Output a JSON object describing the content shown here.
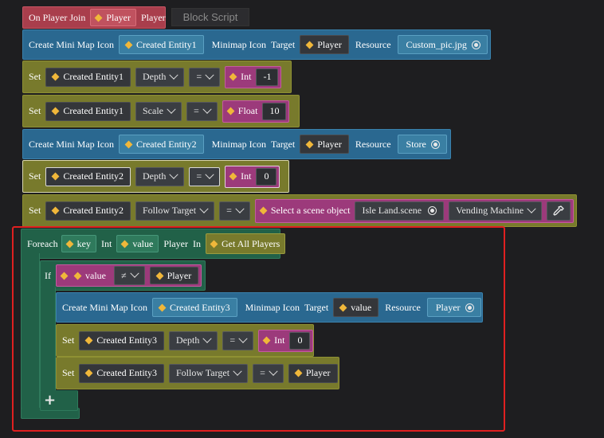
{
  "header": {
    "event_label": "On Player Join",
    "player_chip": "Player",
    "player_text": "Player",
    "block_script_button": "Block Script"
  },
  "rows": {
    "r1": {
      "create": "Create Mini Map Icon",
      "entity": "Created Entity1",
      "minimap": "Minimap Icon",
      "target": "Target",
      "target_val": "Player",
      "resource": "Resource",
      "resource_val": "Custom_pic.jpg"
    },
    "r2": {
      "set": "Set",
      "entity": "Created Entity1",
      "prop": "Depth",
      "op": "=",
      "type": "Int",
      "value": "-1"
    },
    "r3": {
      "set": "Set",
      "entity": "Created Entity1",
      "prop": "Scale",
      "op": "=",
      "type": "Float",
      "value": "10"
    },
    "r4": {
      "create": "Create Mini Map Icon",
      "entity": "Created Entity2",
      "minimap": "Minimap Icon",
      "target": "Target",
      "target_val": "Player",
      "resource": "Resource",
      "resource_val": "Store"
    },
    "r5": {
      "set": "Set",
      "entity": "Created Entity2",
      "prop": "Depth",
      "op": "=",
      "type": "Int",
      "value": "0"
    },
    "r6": {
      "set": "Set",
      "entity": "Created Entity2",
      "prop": "Follow Target",
      "op": "=",
      "scene_label": "Select a scene object",
      "scene_val": "Isle Land.scene",
      "object_val": "Vending Machine"
    },
    "foreach": {
      "label": "Foreach",
      "key": "key",
      "key_type": "Int",
      "value": "value",
      "value_type": "Player",
      "in": "In",
      "source": "Get All Players"
    },
    "ifrow": {
      "label": "If",
      "left": "value",
      "op": "≠",
      "right": "Player"
    },
    "r7": {
      "create": "Create Mini Map Icon",
      "entity": "Created Entity3",
      "minimap": "Minimap Icon",
      "target": "Target",
      "target_val": "value",
      "resource": "Resource",
      "resource_val": "Player"
    },
    "r8": {
      "set": "Set",
      "entity": "Created Entity3",
      "prop": "Depth",
      "op": "=",
      "type": "Int",
      "value": "0"
    },
    "r9": {
      "set": "Set",
      "entity": "Created Entity3",
      "prop": "Follow Target",
      "op": "=",
      "target_val": "Player"
    },
    "add_button": "+"
  },
  "colors": {
    "event": "#a93e4c",
    "action_blue": "#2a6890",
    "set_olive": "#787a2c",
    "loop_green": "#216148",
    "value_pink": "#9c3a7b",
    "selection_outline": "#e02020"
  }
}
